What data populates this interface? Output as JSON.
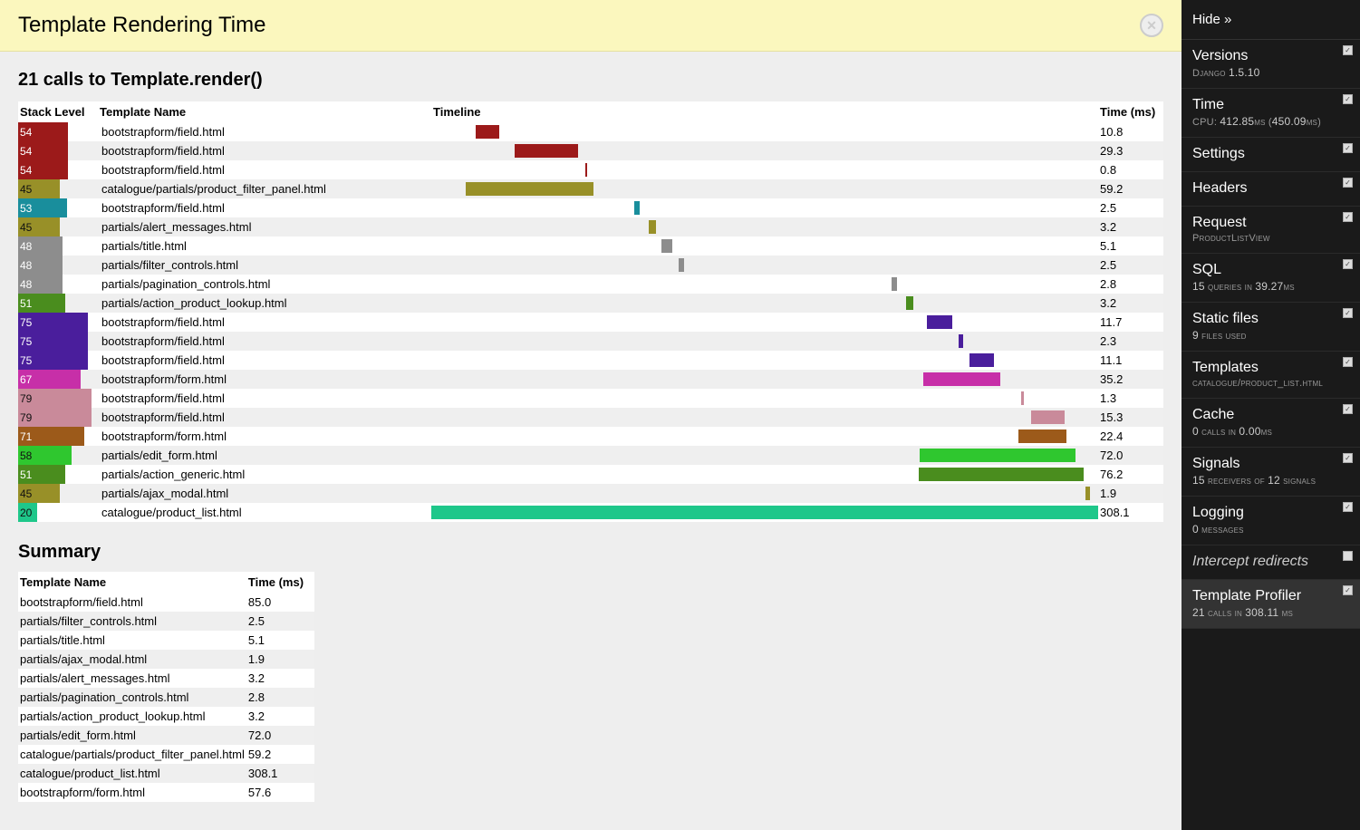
{
  "header": {
    "title": "Template Rendering Time"
  },
  "subtitle": "21 calls to Template.render()",
  "columns": {
    "stack": "Stack Level",
    "name": "Template Name",
    "timeline": "Timeline",
    "time": "Time (ms)"
  },
  "total_time": 308.1,
  "rows": [
    {
      "level": 54,
      "name": "bootstrapform/field.html",
      "time": 10.8,
      "start": 20.4,
      "color": "#9c1a1a",
      "tcolor": "#fff"
    },
    {
      "level": 54,
      "name": "bootstrapform/field.html",
      "time": 29.3,
      "start": 38.6,
      "color": "#9c1a1a",
      "tcolor": "#fff"
    },
    {
      "level": 54,
      "name": "bootstrapform/field.html",
      "time": 0.8,
      "start": 71.1,
      "color": "#9c1a1a",
      "tcolor": "#fff"
    },
    {
      "level": 45,
      "name": "catalogue/partials/product_filter_panel.html",
      "time": 59.2,
      "start": 15.8,
      "color": "#989028",
      "tcolor": "#111"
    },
    {
      "level": 53,
      "name": "bootstrapform/field.html",
      "time": 2.5,
      "start": 93.6,
      "color": "#198e9c",
      "tcolor": "#fff"
    },
    {
      "level": 45,
      "name": "partials/alert_messages.html",
      "time": 3.2,
      "start": 100.6,
      "color": "#989028",
      "tcolor": "#111"
    },
    {
      "level": 48,
      "name": "partials/title.html",
      "time": 5.1,
      "start": 106.3,
      "color": "#8d8d8d",
      "tcolor": "#fff"
    },
    {
      "level": 48,
      "name": "partials/filter_controls.html",
      "time": 2.5,
      "start": 114.4,
      "color": "#8d8d8d",
      "tcolor": "#fff"
    },
    {
      "level": 48,
      "name": "partials/pagination_controls.html",
      "time": 2.8,
      "start": 212.5,
      "color": "#8d8d8d",
      "tcolor": "#fff"
    },
    {
      "level": 51,
      "name": "partials/action_product_lookup.html",
      "time": 3.2,
      "start": 219.3,
      "color": "#4a8d1e",
      "tcolor": "#fff"
    },
    {
      "level": 75,
      "name": "bootstrapform/field.html",
      "time": 11.7,
      "start": 228.8,
      "color": "#4a1e9c",
      "tcolor": "#fff"
    },
    {
      "level": 75,
      "name": "bootstrapform/field.html",
      "time": 2.3,
      "start": 243.6,
      "color": "#4a1e9c",
      "tcolor": "#fff"
    },
    {
      "level": 75,
      "name": "bootstrapform/field.html",
      "time": 11.1,
      "start": 248.8,
      "color": "#4a1e9c",
      "tcolor": "#fff"
    },
    {
      "level": 67,
      "name": "bootstrapform/form.html",
      "time": 35.2,
      "start": 227.5,
      "color": "#c72fa8",
      "tcolor": "#fff"
    },
    {
      "level": 79,
      "name": "bootstrapform/field.html",
      "time": 1.3,
      "start": 272.5,
      "color": "#c98a9a",
      "tcolor": "#111"
    },
    {
      "level": 79,
      "name": "bootstrapform/field.html",
      "time": 15.3,
      "start": 277.2,
      "color": "#c98a9a",
      "tcolor": "#111"
    },
    {
      "level": 71,
      "name": "bootstrapform/form.html",
      "time": 22.4,
      "start": 271.1,
      "color": "#9c5a1a",
      "tcolor": "#fff"
    },
    {
      "level": 58,
      "name": "partials/edit_form.html",
      "time": 72.0,
      "start": 225.8,
      "color": "#2fc72f",
      "tcolor": "#111"
    },
    {
      "level": 51,
      "name": "partials/action_generic.html",
      "time": 76.2,
      "start": 225.2,
      "color": "#4a8d1e",
      "tcolor": "#fff"
    },
    {
      "level": 45,
      "name": "partials/ajax_modal.html",
      "time": 1.9,
      "start": 302.3,
      "color": "#989028",
      "tcolor": "#111"
    },
    {
      "level": 20,
      "name": "catalogue/product_list.html",
      "time": 308.1,
      "start": 0.0,
      "color": "#1ec78a",
      "tcolor": "#111"
    }
  ],
  "max_level": 80,
  "summary_title": "Summary",
  "summary_columns": {
    "name": "Template Name",
    "time": "Time (ms)"
  },
  "summary": [
    {
      "name": "bootstrapform/field.html",
      "time": "85.0"
    },
    {
      "name": "partials/filter_controls.html",
      "time": "2.5"
    },
    {
      "name": "partials/title.html",
      "time": "5.1"
    },
    {
      "name": "partials/ajax_modal.html",
      "time": "1.9"
    },
    {
      "name": "partials/alert_messages.html",
      "time": "3.2"
    },
    {
      "name": "partials/pagination_controls.html",
      "time": "2.8"
    },
    {
      "name": "partials/action_product_lookup.html",
      "time": "3.2"
    },
    {
      "name": "partials/edit_form.html",
      "time": "72.0"
    },
    {
      "name": "catalogue/partials/product_filter_panel.html",
      "time": "59.2"
    },
    {
      "name": "catalogue/product_list.html",
      "time": "308.1"
    },
    {
      "name": "bootstrapform/form.html",
      "time": "57.6"
    }
  ],
  "sidebar": {
    "hide": "Hide »",
    "panels": [
      {
        "title": "Versions",
        "sub_html": "D<sc>jango</sc> <b>1.5.10</b>",
        "checked": true
      },
      {
        "title": "Time",
        "sub_html": "CPU: <b>412.85</b><sc>ms</sc> (<b>450.09</b><sc>ms</sc>)",
        "checked": true
      },
      {
        "title": "Settings",
        "sub_html": "",
        "checked": true
      },
      {
        "title": "Headers",
        "sub_html": "",
        "checked": true
      },
      {
        "title": "Request",
        "sub_html": "P<sc>roduct</sc>L<sc>ist</sc>V<sc>iew</sc>",
        "checked": true
      },
      {
        "title": "SQL",
        "sub_html": "<b>15</b> <sc>queries in</sc> <b>39.27</b><sc>ms</sc>",
        "checked": true
      },
      {
        "title": "Static files",
        "sub_html": "<b>9</b> <sc>files used</sc>",
        "checked": true
      },
      {
        "title": "Templates",
        "sub_html": "<sc>catalogue/product_list.html</sc>",
        "checked": true
      },
      {
        "title": "Cache",
        "sub_html": "<b>0</b> <sc>calls in</sc> <b>0.00</b><sc>ms</sc>",
        "checked": true
      },
      {
        "title": "Signals",
        "sub_html": "<b>15</b> <sc>receivers of</sc> <b>12</b> <sc>signals</sc>",
        "checked": true
      },
      {
        "title": "Logging",
        "sub_html": "<b>0</b> <sc>messages</sc>",
        "checked": true
      },
      {
        "title": "Intercept redirects",
        "sub_html": "",
        "checked": false,
        "intercept": true
      },
      {
        "title": "Template Profiler",
        "sub_html": "<b>21</b> <sc>calls in</sc> <b>308.11</b> <sc>ms</sc>",
        "checked": true,
        "selected": true
      }
    ]
  }
}
